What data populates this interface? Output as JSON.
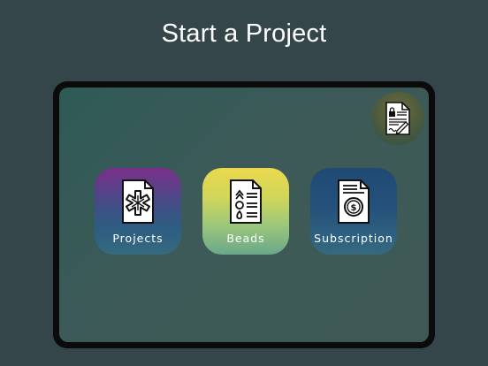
{
  "header": {
    "title": "Start a Project"
  },
  "corner_button": {
    "icon": "document-lock-icon"
  },
  "tiles": [
    {
      "label": "Projects",
      "icon": "document-asterisk-icon",
      "color": "#7a2f8a"
    },
    {
      "label": "Beads",
      "icon": "document-list-icon",
      "color": "#ecd84e"
    },
    {
      "label": "Subscription",
      "icon": "document-dollar-icon",
      "color": "#1f4a74"
    }
  ],
  "colors": {
    "background": "#34464a",
    "tablet_frame": "#0b0b0b",
    "screen": "#3d5a58"
  }
}
